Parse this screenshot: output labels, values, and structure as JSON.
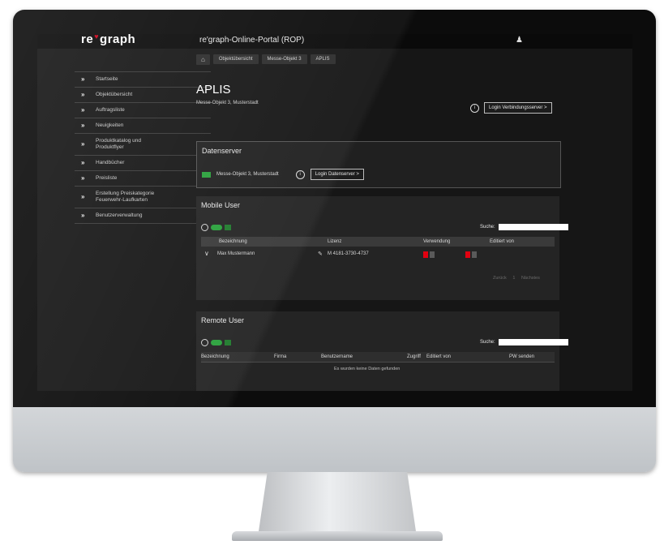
{
  "app": {
    "logo_left": "re",
    "logo_right": "graph",
    "title": "re'graph-Online-Portal (ROP)",
    "user_icon": "user-icon"
  },
  "breadcrumb": [
    "Objektübersicht",
    "Messe-Objekt 3",
    "APLIS"
  ],
  "sidebar": {
    "items": [
      {
        "label": "Startseite"
      },
      {
        "label": "Objektübersicht"
      },
      {
        "label": "Auftragsliste"
      },
      {
        "label": "Neuigkeiten"
      },
      {
        "label": "Produktkatalog und Produktflyer"
      },
      {
        "label": "Handbücher"
      },
      {
        "label": "Preisliste"
      },
      {
        "label": "Erstellung Preiskategorie Feuerwehr-Laufkarten"
      },
      {
        "label": "Benutzerverwaltung"
      }
    ]
  },
  "main": {
    "title": "APLIS",
    "subtitle": "Messe-Objekt 3, Musterstadt",
    "login_button": "Login Verbindungsserver >"
  },
  "dataserver": {
    "heading": "Datenserver",
    "name": "Messe-Objekt 3, Musterstadt",
    "login_button": "Login Datenserver >"
  },
  "mobile_users": {
    "heading": "Mobile User",
    "search_label": "Suche:",
    "columns": [
      "Bezeichnung",
      "Lizenz",
      "Verwendung",
      "Editiert von"
    ],
    "rows": [
      {
        "name": "Max Mustermann",
        "license": "M 4181-3730-4737"
      }
    ],
    "pager": [
      "Zurück",
      "1",
      "Nächstes"
    ]
  },
  "remote_users": {
    "heading": "Remote User",
    "search_label": "Suche:",
    "columns": [
      "Bezeichnung",
      "Firma",
      "Benutzername",
      "Zugriff",
      "Editiert von",
      "PW senden"
    ],
    "empty_text": "Es wurden keine Daten gefunden"
  },
  "colors": {
    "accent_green": "#29a13b",
    "accent_red": "#e10010",
    "logo_heart": "#d0021b"
  }
}
